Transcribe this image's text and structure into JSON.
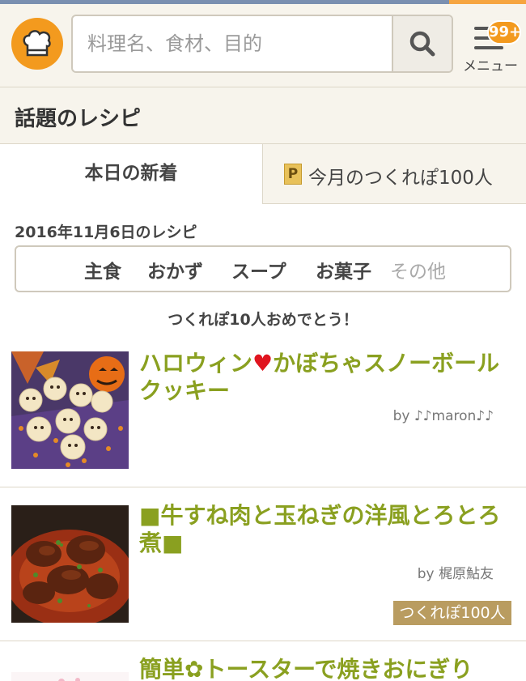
{
  "header": {
    "search_placeholder": "料理名、食材、目的",
    "menu_label": "メニュー",
    "menu_badge": "99+"
  },
  "section": {
    "title": "話題のレシピ"
  },
  "tabs": [
    {
      "label": "本日の新着",
      "active": true
    },
    {
      "label": "今月のつくれぽ100人",
      "active": false,
      "icon_text": "P"
    }
  ],
  "date_label": "2016年11月6日のレシピ",
  "categories": [
    "主食",
    "おかず",
    "スープ",
    "お菓子",
    "その他"
  ],
  "congrats": "つくれぽ10人おめでとう！",
  "recipes": [
    {
      "title_part1": "ハロウィン",
      "title_heart": "♥",
      "title_part2": "かぼちゃスノーボールクッキー",
      "author": "by ♪♪maron♪♪"
    },
    {
      "title": "■牛すね肉と玉ねぎの洋風とろとろ煮■",
      "author": "by 梶原鮎友",
      "badge": "つくれぽ100人"
    },
    {
      "title_part1": "簡単",
      "title_flower": "✿",
      "title_part2": "トースターで焼きおにぎり"
    }
  ],
  "colors": {
    "brand_orange": "#f39a1e",
    "title_green": "#8aa020",
    "badge_gold": "#b99c60",
    "header_bg": "#f7f4ec"
  }
}
